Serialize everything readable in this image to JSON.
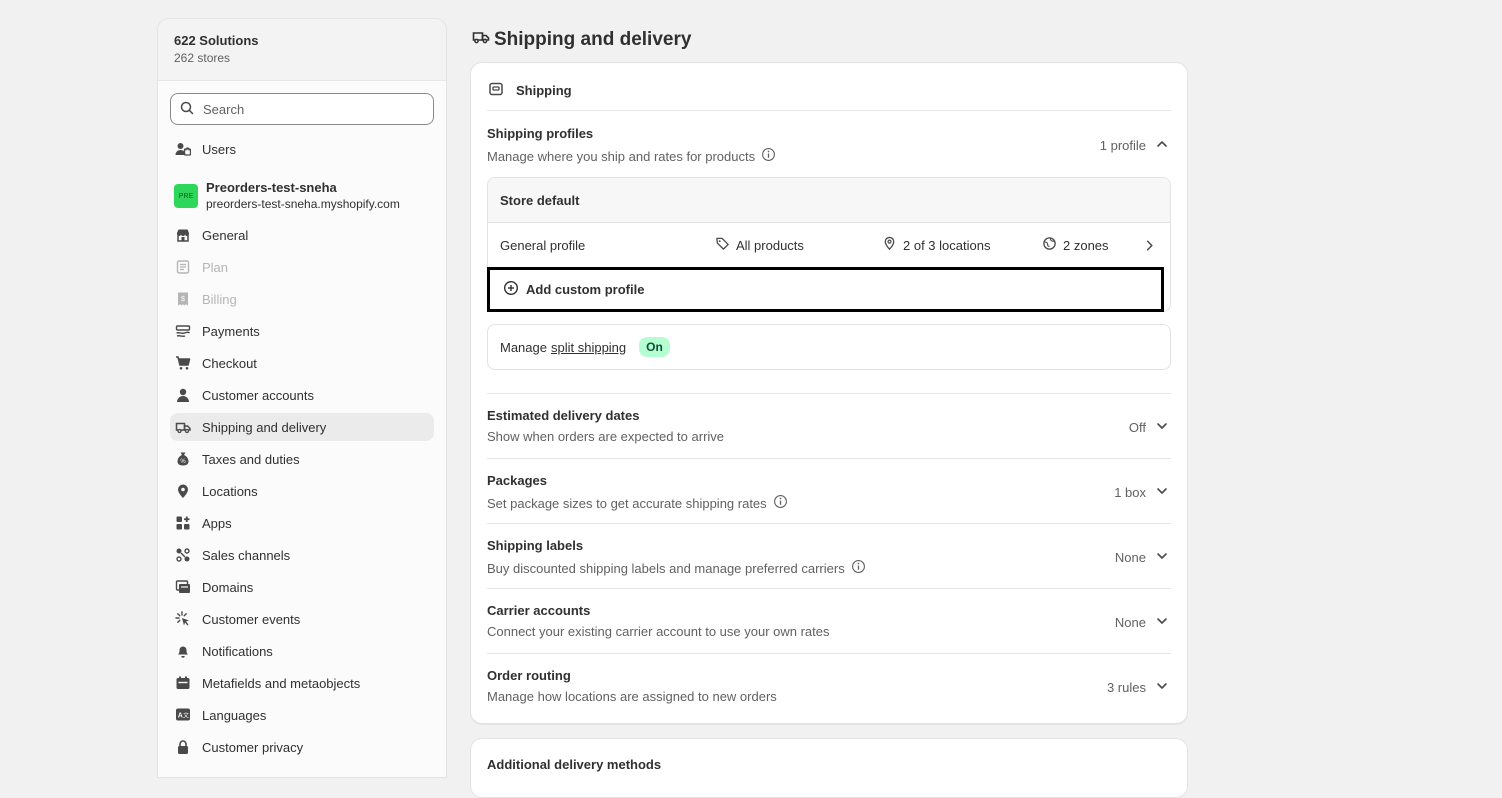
{
  "org": {
    "name": "622 Solutions",
    "stores": "262 stores"
  },
  "search": {
    "placeholder": "Search"
  },
  "users_label": "Users",
  "store": {
    "badge": "PRE",
    "name": "Preorders-test-sneha",
    "url": "preorders-test-sneha.myshopify.com"
  },
  "nav": [
    {
      "label": "General",
      "icon": "store-icon",
      "state": "normal"
    },
    {
      "label": "Plan",
      "icon": "plan-icon",
      "state": "disabled"
    },
    {
      "label": "Billing",
      "icon": "billing-icon",
      "state": "disabled"
    },
    {
      "label": "Payments",
      "icon": "payments-icon",
      "state": "normal"
    },
    {
      "label": "Checkout",
      "icon": "cart-icon",
      "state": "normal"
    },
    {
      "label": "Customer accounts",
      "icon": "person-icon",
      "state": "normal"
    },
    {
      "label": "Shipping and delivery",
      "icon": "truck-icon",
      "state": "active"
    },
    {
      "label": "Taxes and duties",
      "icon": "tax-icon",
      "state": "normal"
    },
    {
      "label": "Locations",
      "icon": "location-icon",
      "state": "normal"
    },
    {
      "label": "Apps",
      "icon": "apps-icon",
      "state": "normal"
    },
    {
      "label": "Sales channels",
      "icon": "channels-icon",
      "state": "normal"
    },
    {
      "label": "Domains",
      "icon": "domains-icon",
      "state": "normal"
    },
    {
      "label": "Customer events",
      "icon": "cursor-icon",
      "state": "normal"
    },
    {
      "label": "Notifications",
      "icon": "bell-icon",
      "state": "normal"
    },
    {
      "label": "Metafields and metaobjects",
      "icon": "metafields-icon",
      "state": "normal"
    },
    {
      "label": "Languages",
      "icon": "language-icon",
      "state": "normal"
    },
    {
      "label": "Customer privacy",
      "icon": "lock-icon",
      "state": "normal"
    }
  ],
  "page": {
    "title": "Shipping and delivery"
  },
  "shipping_card": {
    "heading": "Shipping",
    "profiles": {
      "title": "Shipping profiles",
      "desc": "Manage where you ship and rates for products",
      "value": "1 profile",
      "store_default": "Store default",
      "general_profile": "General profile",
      "products": "All products",
      "locations": "2 of 3 locations",
      "zones": "2 zones",
      "add_custom": "Add custom profile"
    },
    "split": {
      "prefix": "Manage",
      "link": "split shipping",
      "badge": "On"
    },
    "sections": [
      {
        "title": "Estimated delivery dates",
        "desc": "Show when orders are expected to arrive",
        "value": "Off",
        "info": false
      },
      {
        "title": "Packages",
        "desc": "Set package sizes to get accurate shipping rates",
        "value": "1 box",
        "info": true
      },
      {
        "title": "Shipping labels",
        "desc": "Buy discounted shipping labels and manage preferred carriers",
        "value": "None",
        "info": true
      },
      {
        "title": "Carrier accounts",
        "desc": "Connect your existing carrier account to use your own rates",
        "value": "None",
        "info": false
      },
      {
        "title": "Order routing",
        "desc": "Manage how locations are assigned to new orders",
        "value": "3 rules",
        "info": false
      }
    ]
  },
  "next_card": {
    "title": "Additional delivery methods"
  },
  "colors": {
    "accent_badge": "#b4fed2",
    "store_badge": "#2ed65a",
    "active_nav": "#ebebeb"
  }
}
